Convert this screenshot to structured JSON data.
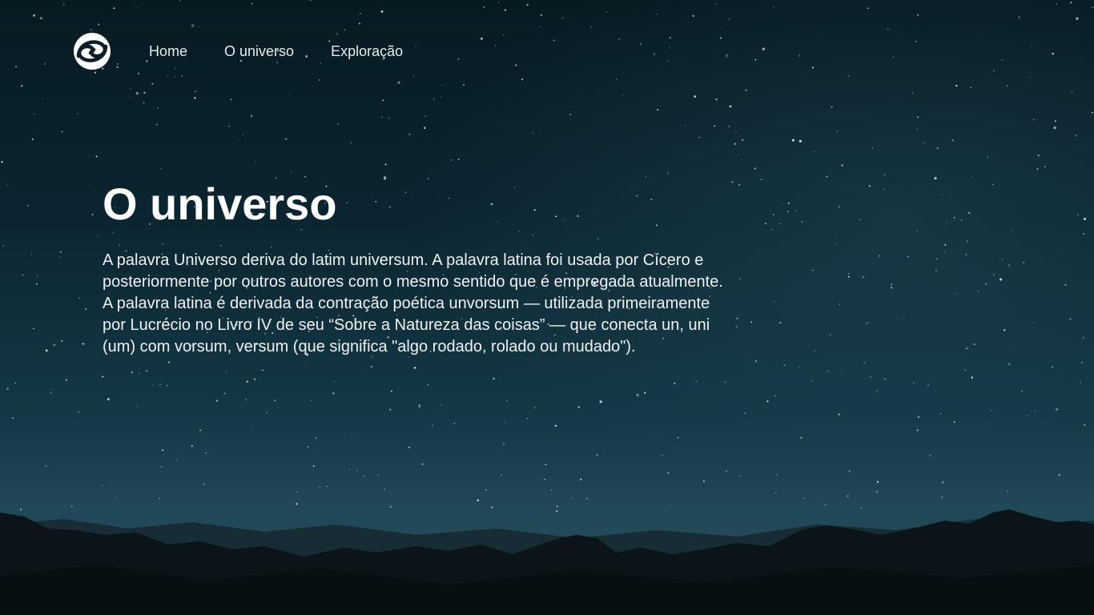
{
  "nav": {
    "logo_icon": "spiral-galaxy-icon",
    "links": [
      {
        "label": "Home"
      },
      {
        "label": "O universo"
      },
      {
        "label": "Exploração"
      }
    ]
  },
  "hero": {
    "title": "O universo",
    "paragraph": "A palavra Universo deriva do latim universum. A palavra latina foi usada por Cícero e posteriormente por outros autores com o mesmo sentido que é empregada atualmente. A palavra latina é derivada da contração poética unvorsum — utilizada primeiramente por Lucrécio no Livro IV de seu “Sobre a Natureza das coisas” — que conecta un, uni (um) com vorsum, versum (que significa \"algo rodado, rolado ou mudado\")."
  },
  "colors": {
    "sky_top": "#071a22",
    "sky_mid": "#133744",
    "horizon_glow": "#1c4150",
    "mountains": "#0a1419",
    "text": "#ffffff"
  }
}
